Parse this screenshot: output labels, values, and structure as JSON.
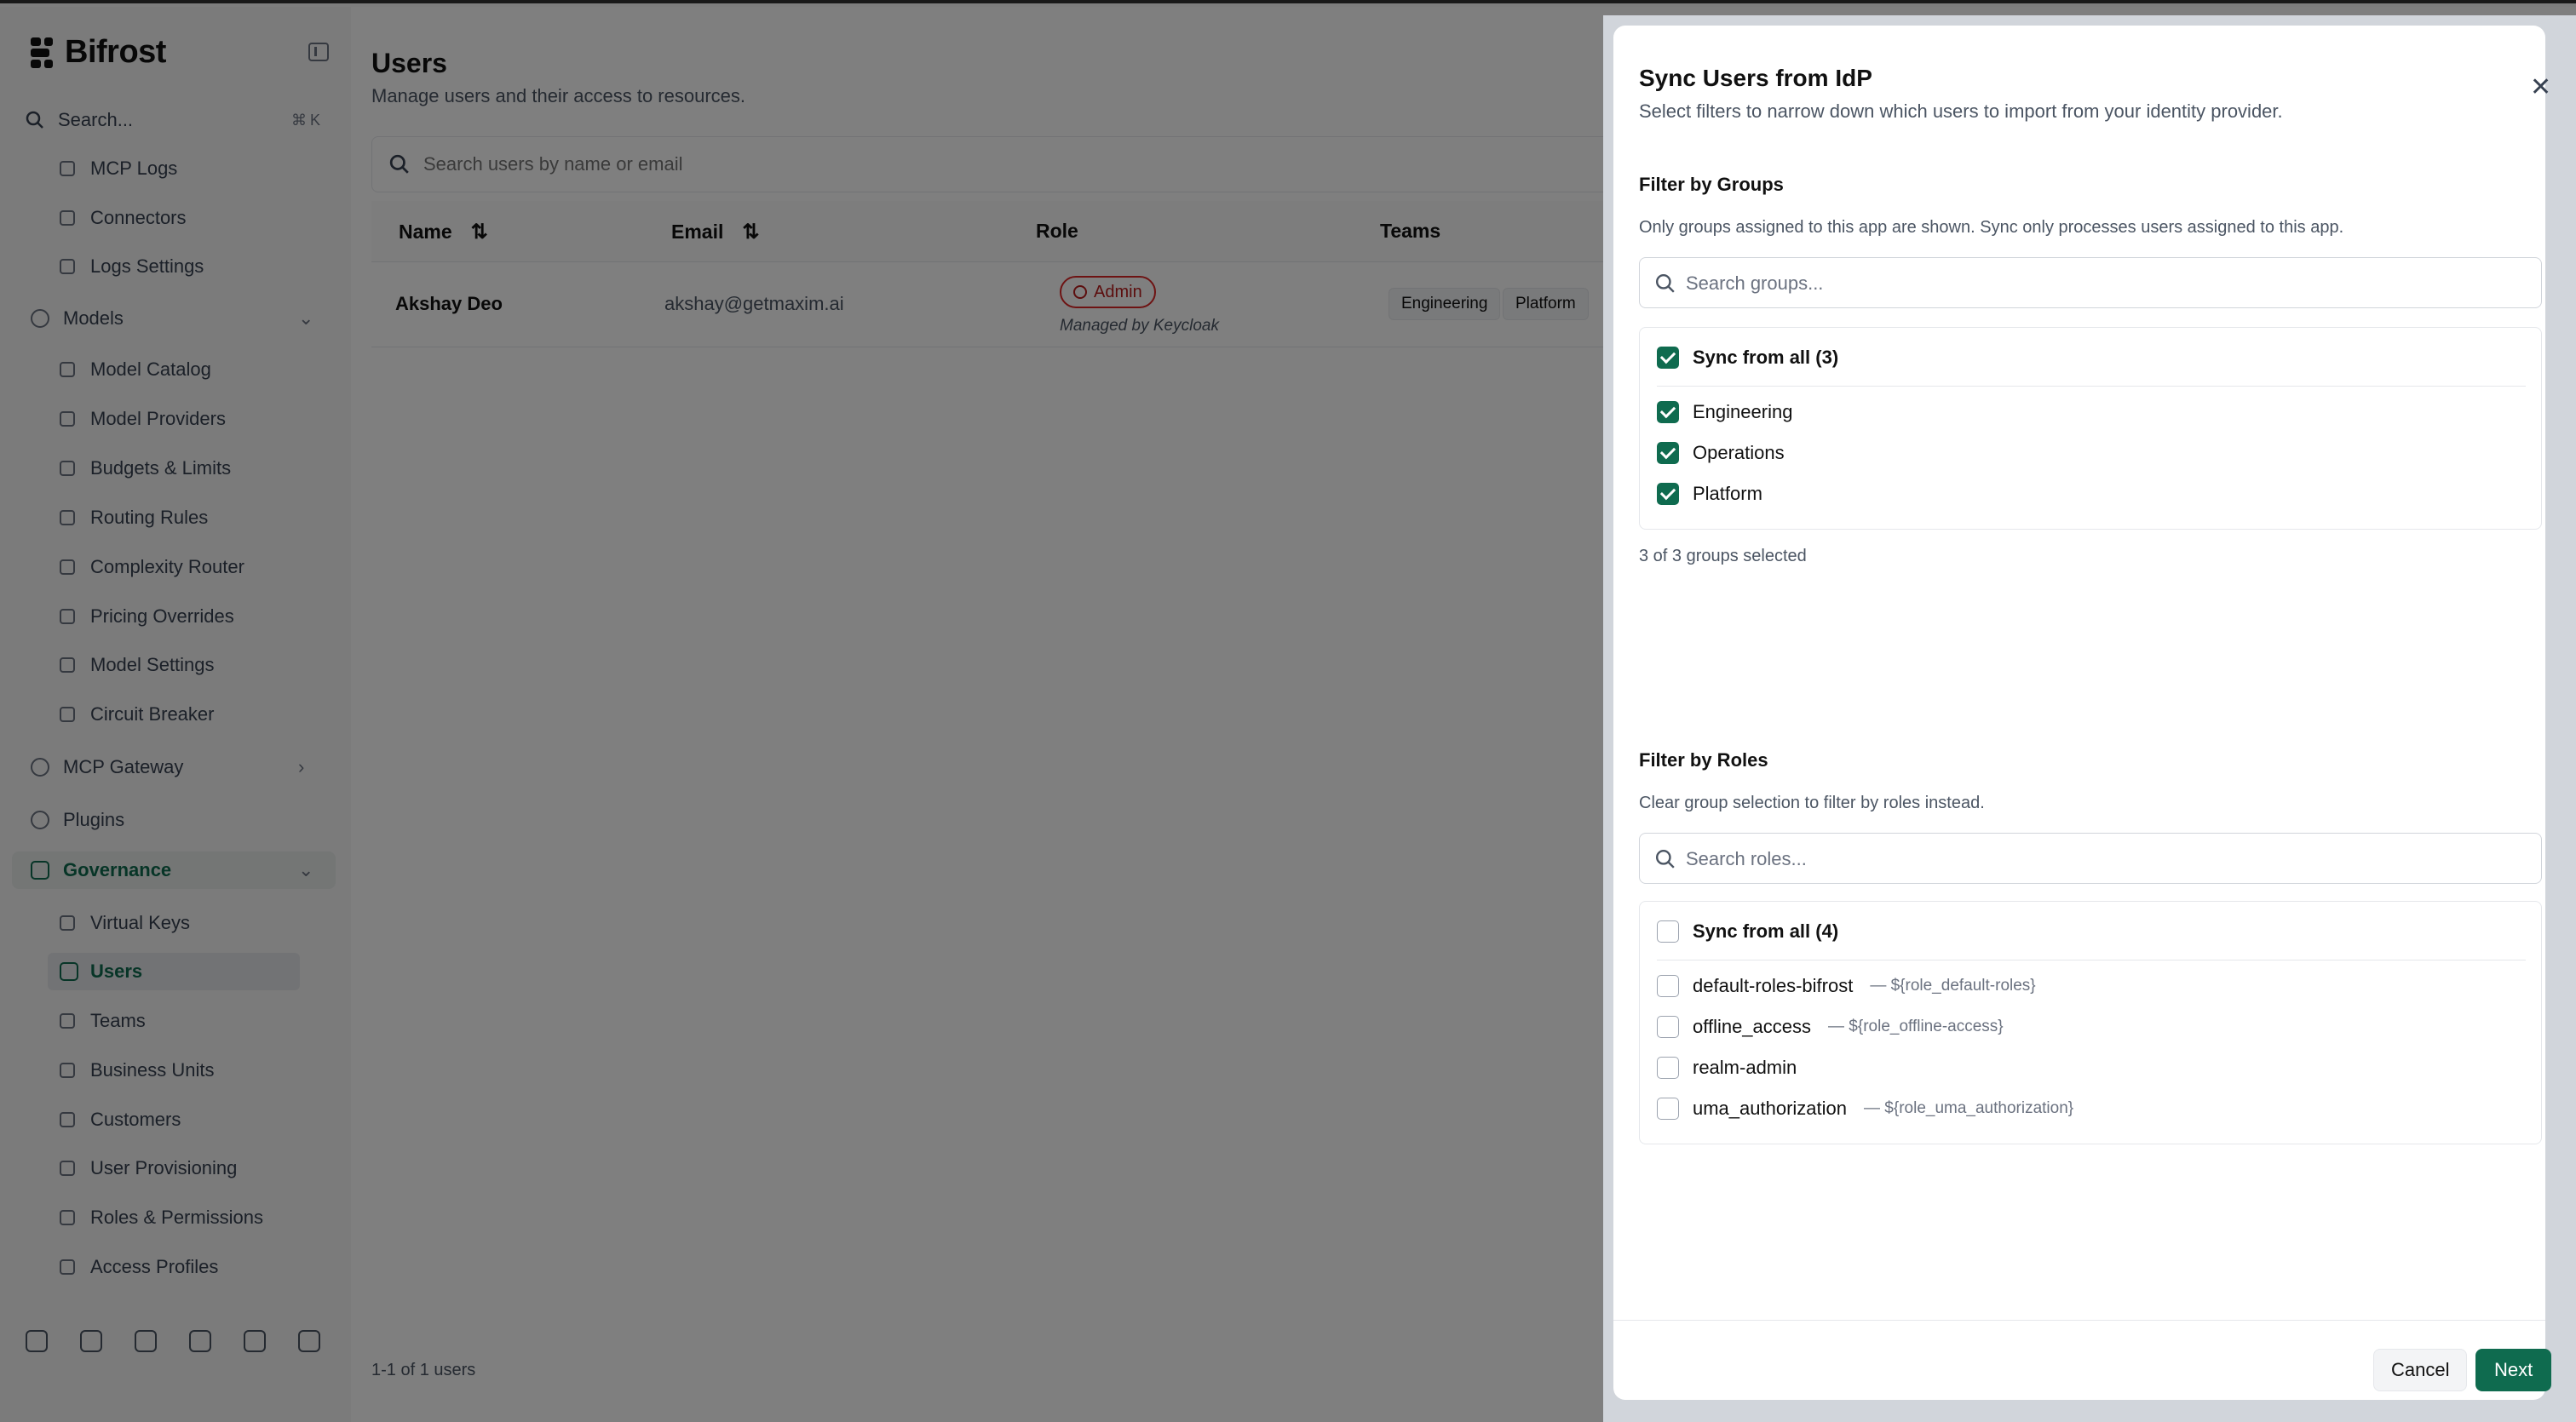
{
  "app": {
    "name": "Bifrost"
  },
  "sidebar": {
    "search_label": "Search...",
    "search_shortcut": "⌘K",
    "items": [
      {
        "label": "MCP Logs"
      },
      {
        "label": "Connectors"
      },
      {
        "label": "Logs Settings"
      },
      {
        "label": "Models"
      },
      {
        "label": "Model Catalog"
      },
      {
        "label": "Model Providers"
      },
      {
        "label": "Budgets & Limits"
      },
      {
        "label": "Routing Rules"
      },
      {
        "label": "Complexity Router"
      },
      {
        "label": "Pricing Overrides"
      },
      {
        "label": "Model Settings"
      },
      {
        "label": "Circuit Breaker"
      },
      {
        "label": "MCP Gateway"
      },
      {
        "label": "Plugins"
      },
      {
        "label": "Governance"
      },
      {
        "label": "Virtual Keys"
      },
      {
        "label": "Users"
      },
      {
        "label": "Teams"
      },
      {
        "label": "Business Units"
      },
      {
        "label": "Customers"
      },
      {
        "label": "User Provisioning"
      },
      {
        "label": "Roles & Permissions"
      },
      {
        "label": "Access Profiles"
      }
    ]
  },
  "page": {
    "title": "Users",
    "subtitle": "Manage users and their access to resources.",
    "search_placeholder": "Search users by name or email",
    "columns": [
      "Name",
      "Email",
      "Role",
      "Teams"
    ],
    "rows": [
      {
        "name": "Akshay Deo",
        "email": "akshay@getmaxim.ai",
        "role": "Admin",
        "role_note": "Managed by Keycloak",
        "teams": [
          "Engineering",
          "Platform"
        ]
      }
    ],
    "pagination": "1-1 of 1 users"
  },
  "dialog": {
    "title": "Sync Users from IdP",
    "description": "Select filters to narrow down which users to import from your identity provider.",
    "groups": {
      "title": "Filter by Groups",
      "description": "Only groups assigned to this app are shown. Sync only processes users assigned to this app.",
      "search_placeholder": "Search groups...",
      "sync_all_label": "Sync from all (3)",
      "sync_all_checked": true,
      "items": [
        {
          "label": "Engineering",
          "checked": true
        },
        {
          "label": "Operations",
          "checked": true
        },
        {
          "label": "Platform",
          "checked": true
        }
      ],
      "selected_count": "3 of 3 groups selected"
    },
    "roles": {
      "title": "Filter by Roles",
      "description": "Clear group selection to filter by roles instead.",
      "search_placeholder": "Search roles...",
      "sync_all_label": "Sync from all (4)",
      "sync_all_checked": false,
      "items": [
        {
          "label": "default-roles-bifrost",
          "hint": "— ${role_default-roles}",
          "checked": false
        },
        {
          "label": "offline_access",
          "hint": "— ${role_offline-access}",
          "checked": false
        },
        {
          "label": "realm-admin",
          "hint": "",
          "checked": false
        },
        {
          "label": "uma_authorization",
          "hint": "— ${role_uma_authorization}",
          "checked": false
        }
      ]
    },
    "buttons": {
      "cancel": "Cancel",
      "next": "Next"
    }
  },
  "colors": {
    "accent": "#0f6b4f",
    "danger": "#dc2626"
  }
}
